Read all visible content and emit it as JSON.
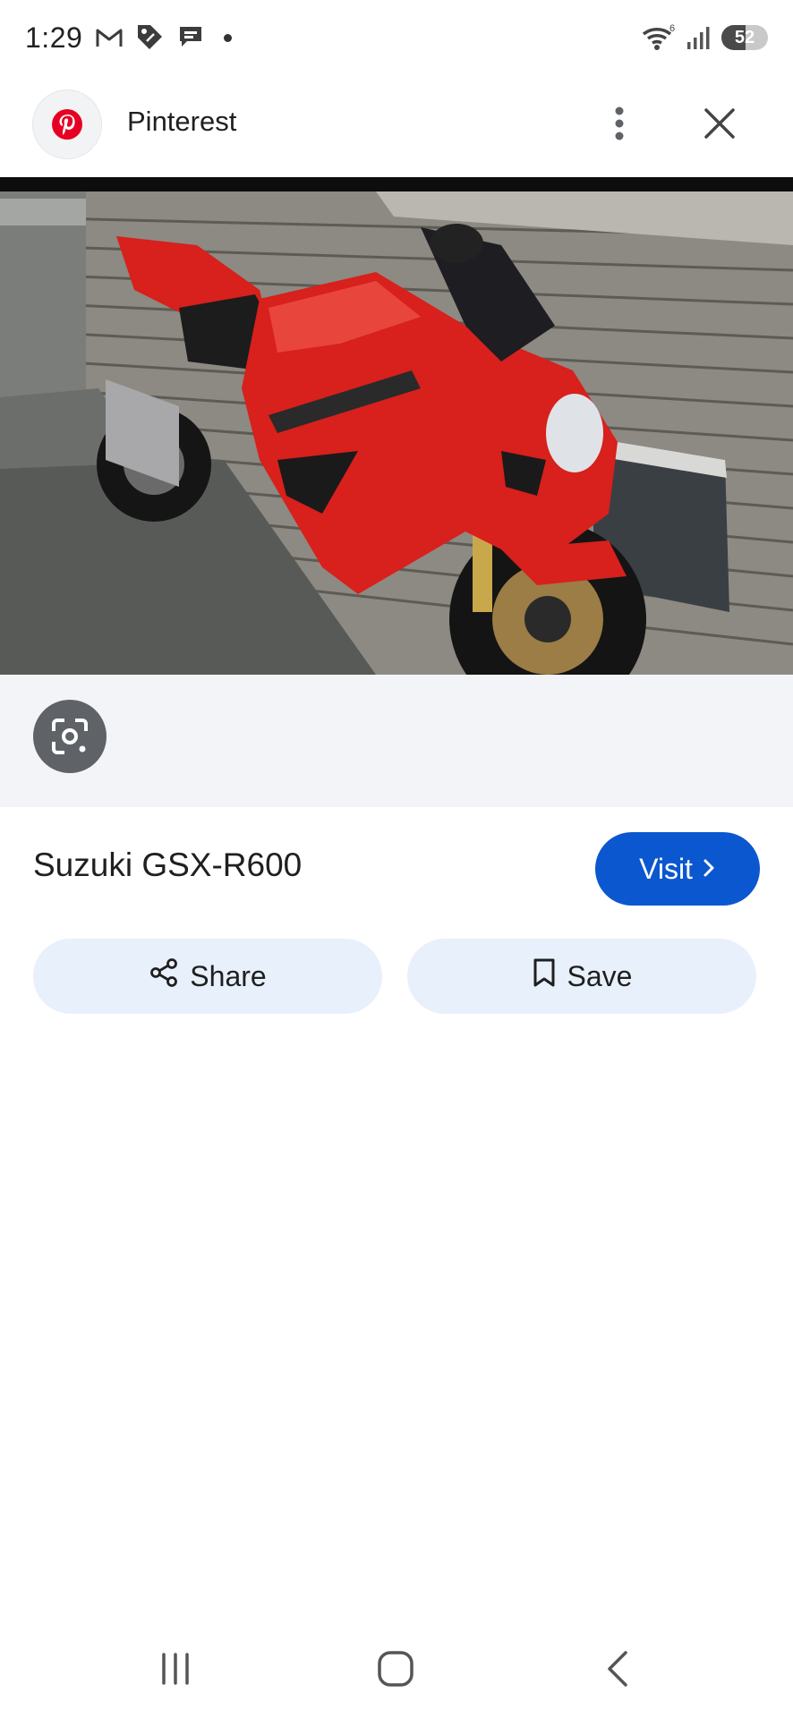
{
  "status_bar": {
    "time": "1:29",
    "battery": "52",
    "battery_level_percent": 52,
    "wifi_badge": "6",
    "icons": [
      "gmail-icon",
      "tag-icon",
      "messages-icon",
      "notification-dot-icon",
      "wifi-icon",
      "signal-icon",
      "battery-icon"
    ]
  },
  "header": {
    "site_name": "Pinterest",
    "avatar_icon": "pinterest-logo-icon",
    "menu_icon": "more-vert-icon",
    "close_icon": "close-icon"
  },
  "image": {
    "subject_icon": "motorcycle-photo"
  },
  "lens": {
    "icon": "google-lens-icon"
  },
  "result": {
    "title": "Suzuki GSX-R600",
    "visit_label": "Visit"
  },
  "actions": {
    "share_label": "Share",
    "save_label": "Save"
  },
  "nav": {
    "icons": [
      "recent-apps-icon",
      "home-icon",
      "back-icon"
    ]
  },
  "colors": {
    "accent": "#0b57d0",
    "pill_bg": "#e8f0fb",
    "lens_strip_bg": "#f2f4f7",
    "pinterest_red": "#e60023",
    "motorcycle_red": "#d8201c"
  }
}
